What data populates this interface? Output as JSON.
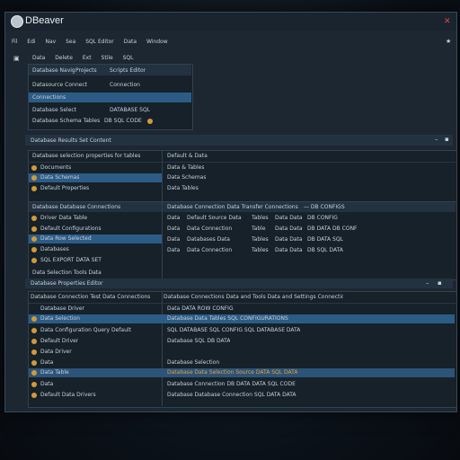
{
  "app": {
    "title": "DBeaver",
    "close_label": "✕",
    "star_label": "★"
  },
  "menu": [
    "Fil",
    "Edi",
    "Nav",
    "Sea",
    "SQL Editor",
    "Data",
    "Window"
  ],
  "toolbar_icon": "▣",
  "nav_tabs": [
    "Data",
    "Delete",
    "Ext",
    "Stile",
    "SQL"
  ],
  "nav": {
    "header": [
      "Database Navig",
      "Projects",
      "Scripts Editor"
    ],
    "rows": [
      [
        "Datasource Connect",
        "Connection"
      ],
      [
        "Connections",
        ""
      ],
      [
        "Database Select",
        "DATABASE SQL"
      ],
      [
        "Database Schema Tables",
        "DB SQL CODE"
      ]
    ]
  },
  "section1": {
    "title": "Database Results Set Content",
    "minimize": "–",
    "maximize": "▪"
  },
  "props": {
    "header": "Database selection properties for tables",
    "rows": [
      "Documents",
      "Data Schemas",
      "Default Properties"
    ],
    "right_header": "Default & Data",
    "right_rows": [
      "Data & Tables",
      "Data Schemas",
      "Data Tables"
    ]
  },
  "grid": {
    "header": [
      "Database Database Connections",
      "Database Connection Data Transfer Connections",
      "— DB CONFIGS"
    ],
    "left_rows": [
      "Driver Data Table",
      "Default Configurations",
      "Data Row Selected",
      "Databases",
      "SQL EXPORT DATA SET"
    ],
    "footer": "Data Selection Tools Data",
    "mid_rows": [
      [
        "Data",
        "Default Source Data",
        "Tables",
        "Data Data",
        "DB CONFIG"
      ],
      [
        "Data",
        "Data Connection",
        "Table",
        "Data Data",
        "DB DATA DB CONF"
      ],
      [
        "Data",
        "Databases Data",
        "Tables",
        "Data Data",
        "DB DATA SQL"
      ],
      [
        "Data",
        "Data Connection",
        "Tables",
        "Data Data",
        "DB SQL DATA"
      ]
    ]
  },
  "section2": {
    "title": "Database Properties Editor",
    "minimize": "–",
    "maximize": "▪"
  },
  "bottom": {
    "header": [
      "Database Connection Test Data Connections",
      "Database Connections Data and Tools Data and Settings Connections"
    ],
    "rows": [
      [
        "Database Driver",
        "Data DATA ROW CONFIG"
      ],
      [
        "Data Selection",
        "Database Data Tables SQL CONFIGURATIONS"
      ],
      [
        "Data Configuration Query Default",
        "SQL DATABASE SQL CONFIG SQL DATABASE DATA"
      ],
      [
        "Default Driver",
        "Database SQL DB DATA"
      ],
      [
        "Data Driver",
        ""
      ],
      [
        "Data",
        "Database Selection"
      ],
      [
        "Data Table",
        "Database Data Selection Source DATA SQL DATA"
      ],
      [
        "Data",
        "Database Connection DB DATA DATA SQL CODE"
      ],
      [
        "Default Data Drivers",
        "Database Database Connection SQL DATA DATA"
      ]
    ]
  }
}
